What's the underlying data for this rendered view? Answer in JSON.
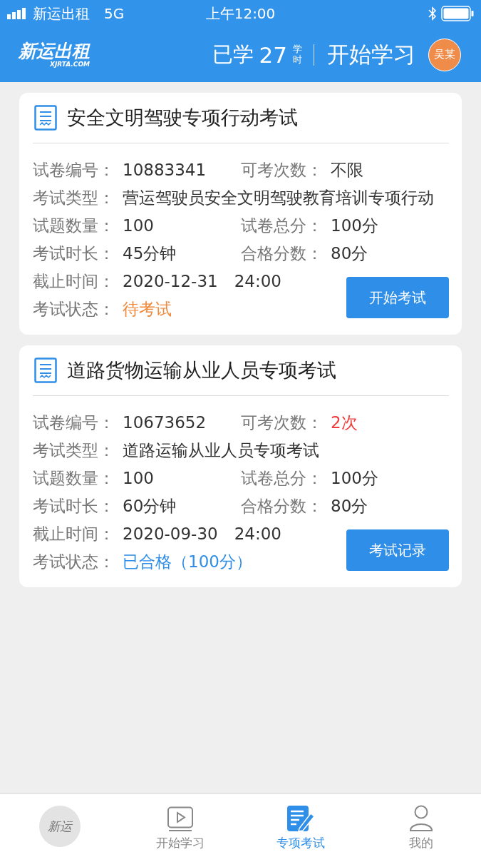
{
  "status_bar": {
    "carrier": "新运出租",
    "network": "5G",
    "time": "上午12:00"
  },
  "header": {
    "logo": "新运出租",
    "logo_sub": "XJRTA.COM",
    "studied_label": "已学",
    "studied_hours": "27",
    "hours_unit": "学时",
    "start_link": "开始学习",
    "avatar": "吴某"
  },
  "cards": [
    {
      "title": "安全文明驾驶专项行动考试",
      "rows": [
        [
          {
            "label": "试卷编号：",
            "value": "10883341"
          },
          {
            "label": "可考次数：",
            "value": "不限",
            "color": "#333333"
          }
        ],
        [
          {
            "label": "考试类型：",
            "value": "营运驾驶员安全文明驾驶教育培训专项行动"
          }
        ],
        [
          {
            "label": "试题数量：",
            "value": "100"
          },
          {
            "label": "试卷总分：",
            "value": "100分"
          }
        ],
        [
          {
            "label": "考试时长：",
            "value": "45分钟"
          },
          {
            "label": "合格分数：",
            "value": "80分"
          }
        ]
      ],
      "deadline": {
        "label": "截止时间：",
        "value": "2020-12-31　24:00"
      },
      "status": {
        "label": "考试状态：",
        "value": "待考试",
        "color": "#f0883a"
      },
      "button": "开始考试"
    },
    {
      "title": "道路货物运输从业人员专项考试",
      "rows": [
        [
          {
            "label": "试卷编号：",
            "value": "10673652"
          },
          {
            "label": "可考次数：",
            "value": "2次",
            "color": "#f03c3c"
          }
        ],
        [
          {
            "label": "考试类型：",
            "value": "道路运输从业人员专项考试"
          }
        ],
        [
          {
            "label": "试题数量：",
            "value": "100"
          },
          {
            "label": "试卷总分：",
            "value": "100分"
          }
        ],
        [
          {
            "label": "考试时长：",
            "value": "60分钟"
          },
          {
            "label": "合格分数：",
            "value": "80分"
          }
        ]
      ],
      "deadline": {
        "label": "截止时间：",
        "value": "2020-09-30　24:00"
      },
      "status": {
        "label": "考试状态：",
        "value": "已合格（100分）",
        "color": "#2e8ee8"
      },
      "button": "考试记录"
    }
  ],
  "tab_bar": [
    {
      "kind": "logo",
      "label": "新运",
      "selected": false
    },
    {
      "kind": "play",
      "label": "开始学习",
      "selected": false
    },
    {
      "kind": "exam",
      "label": "专项考试",
      "selected": true
    },
    {
      "kind": "person",
      "label": "我的",
      "selected": false
    }
  ]
}
